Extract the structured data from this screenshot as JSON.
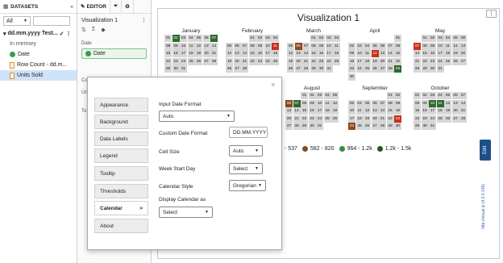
{
  "datasets": {
    "title": "DATASETS",
    "filter": "All",
    "dataset_name": "dd.mm.yyyy Test...",
    "storage": "In memory",
    "fields": [
      "Date",
      "Row Count - dd.m...",
      "Units Sold"
    ]
  },
  "editor": {
    "tab_label": "EDITOR",
    "viz_name": "Visualization 1",
    "date_label": "Date",
    "date_chip": "Date",
    "partial_labels": [
      "Co",
      "Un",
      "To"
    ]
  },
  "viz": {
    "title": "Visualization 1",
    "months": [
      {
        "name": "January",
        "offset": 0,
        "days": 31
      },
      {
        "name": "February",
        "offset": 3,
        "days": 28
      },
      {
        "name": "March",
        "offset": 3,
        "days": 31
      },
      {
        "name": "April",
        "offset": 6,
        "days": 30
      },
      {
        "name": "May",
        "offset": 1,
        "days": 31
      },
      {
        "name": "August",
        "offset": 2,
        "days": 31
      },
      {
        "name": "September",
        "offset": 5,
        "days": 30
      },
      {
        "name": "October",
        "offset": 0,
        "days": 31
      }
    ],
    "legend": [
      "- 537",
      "582 - 820",
      "964 - 1.2k",
      "1.2k - 1.5k"
    ],
    "legend_colors": [
      "#8a4a1c",
      "#3a8a3a",
      "#1f5a1f"
    ],
    "edit_label": "Edit",
    "credit": "http://visual.ly (4.3.0.149)"
  },
  "dialog": {
    "nav": [
      "Appearance",
      "Background",
      "Data Labels",
      "Legend",
      "Tooltip",
      "Thresholds",
      "Calendar",
      "About"
    ],
    "active_arrow": ">",
    "input_date_format_label": "Input Date Format",
    "input_date_format_value": "Auto",
    "custom_date_format_label": "Custom Date Format",
    "custom_date_format_value": "DD.MM.YYYY",
    "cell_size_label": "Cell Size",
    "cell_size_value": "Auto",
    "week_start_label": "Week Start Day",
    "week_start_value": "Select",
    "calendar_style_label": "Calendar Style",
    "calendar_style_value": "Gregorian",
    "display_calendar_label": "Display Calendar as",
    "display_calendar_value": "Select",
    "close": "×"
  }
}
